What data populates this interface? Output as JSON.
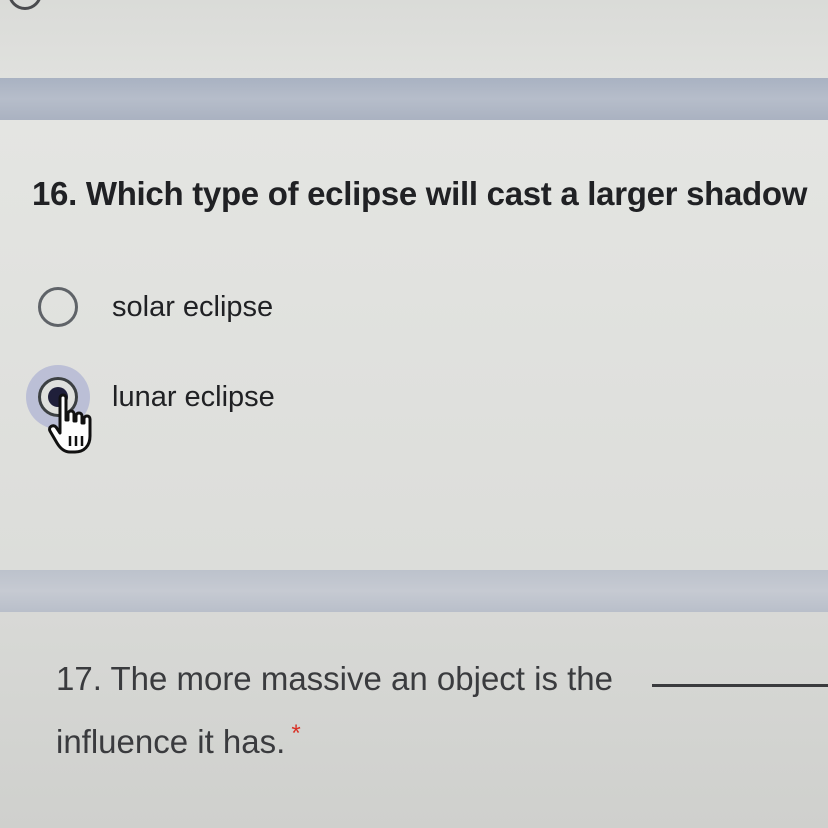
{
  "question_16": {
    "title": "16. Which type of eclipse will cast a larger shadow",
    "options": [
      {
        "label": "solar eclipse",
        "selected": false
      },
      {
        "label": "lunar eclipse",
        "selected": true
      }
    ]
  },
  "question_17": {
    "line1": "17. The more massive an object is the",
    "line2": "influence it has.",
    "required_marker": "*"
  },
  "colors": {
    "selection_halo": "#7882c8",
    "required": "#d93025",
    "divider": "#aab2c1"
  },
  "icons": {
    "cursor": "hand-pointer-icon"
  }
}
